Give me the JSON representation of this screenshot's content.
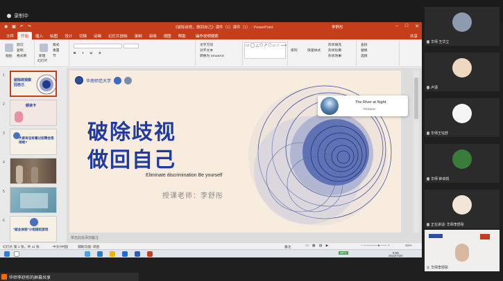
{
  "recording": {
    "label": "录制中"
  },
  "ppt": {
    "title": "《破除歧视，做回自己》课件（1）课件（1）  -  PowerPoint",
    "user": "李舒彤",
    "share_label": "共享",
    "tabs": [
      "文件",
      "开始",
      "插入",
      "绘图",
      "设计",
      "切换",
      "动画",
      "幻灯片放映",
      "录制",
      "审阅",
      "视图",
      "帮助",
      "操作说明搜索"
    ],
    "ribbon": {
      "paste": "粘贴",
      "cut": "剪切",
      "copy": "复制",
      "format_painter": "格式刷",
      "new_slide": "新建",
      "new_slide2": "幻灯片",
      "layout": "版式",
      "reset": "重置",
      "section": "节",
      "text_direction": "文字方向",
      "align_text": "对齐文本",
      "smartart": "转换为 SmartArt",
      "arrange": "排列",
      "quick_styles": "快速样式",
      "shape_fill": "形状填充",
      "shape_outline": "形状轮廓",
      "shape_effects": "形状效果",
      "find": "查找",
      "replace": "替换",
      "select": "选择"
    },
    "thumbnails": [
      {
        "num": "1",
        "text": "破除歧视做回自己"
      },
      {
        "num": "2",
        "text": "朗读卡"
      },
      {
        "num": "3",
        "text": "大家有没有看过招聘会现场呢?"
      },
      {
        "num": "4",
        "text": ""
      },
      {
        "num": "5",
        "text": ""
      },
      {
        "num": "6",
        "text": "\"就业体验\"小组接招游戏"
      }
    ],
    "slide": {
      "school_name": "华南师范大学",
      "title_line1": "破除歧视",
      "title_line2": "做回自己",
      "subtitle": "Eliminate discrimination Be yourself",
      "teacher": "授课老师：李舒彤"
    },
    "notes_placeholder": "单击此处添加备注",
    "status": {
      "slide_info": "幻灯片 第 1 张，共 11 张",
      "language": "中文(中国)",
      "accessibility": "辅助功能: 调查",
      "notes": "备注",
      "zoom": "41%"
    }
  },
  "music": {
    "song": "The River at Night",
    "artist": "Pinkacle"
  },
  "taskbar": {
    "weather": "29°C",
    "time": "8:59",
    "date": "2022/7/20"
  },
  "participants": [
    {
      "name": "华师 王华立"
    },
    {
      "name": "卢潇"
    },
    {
      "name": "华师王钰舒"
    },
    {
      "name": "华师 钟卓凯"
    },
    {
      "name": "正在讲话: 华师李舒彤"
    },
    {
      "name": "华师李舒彤"
    }
  ],
  "share_status": "华师李舒彤的屏幕共享",
  "colors": {
    "ppt_accent": "#c43e1c",
    "title_blue": "#1f3aa0"
  }
}
